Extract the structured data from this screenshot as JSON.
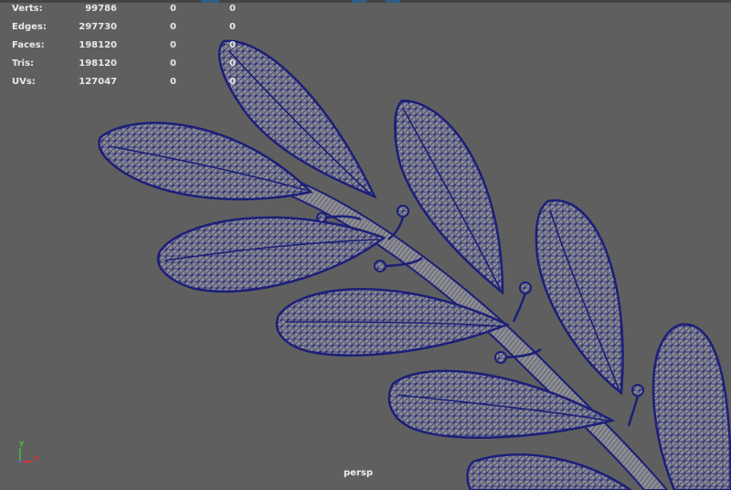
{
  "hud": {
    "rows": [
      {
        "label": "Verts:",
        "total": "99786",
        "selected": "0",
        "comp": "0"
      },
      {
        "label": "Edges:",
        "total": "297730",
        "selected": "0",
        "comp": "0"
      },
      {
        "label": "Faces:",
        "total": "198120",
        "selected": "0",
        "comp": "0"
      },
      {
        "label": "Tris:",
        "total": "198120",
        "selected": "0",
        "comp": "0"
      },
      {
        "label": "UVs:",
        "total": "127047",
        "selected": "0",
        "comp": "0"
      }
    ]
  },
  "camera": {
    "name": "persp"
  },
  "axis": {
    "x_label": "x",
    "y_label": "y",
    "x_color": "#e03030",
    "y_color": "#3fc13f"
  },
  "colors": {
    "wire": "#1c1f78",
    "fill": "#8f8f8f",
    "background": "#5f5f5f"
  }
}
